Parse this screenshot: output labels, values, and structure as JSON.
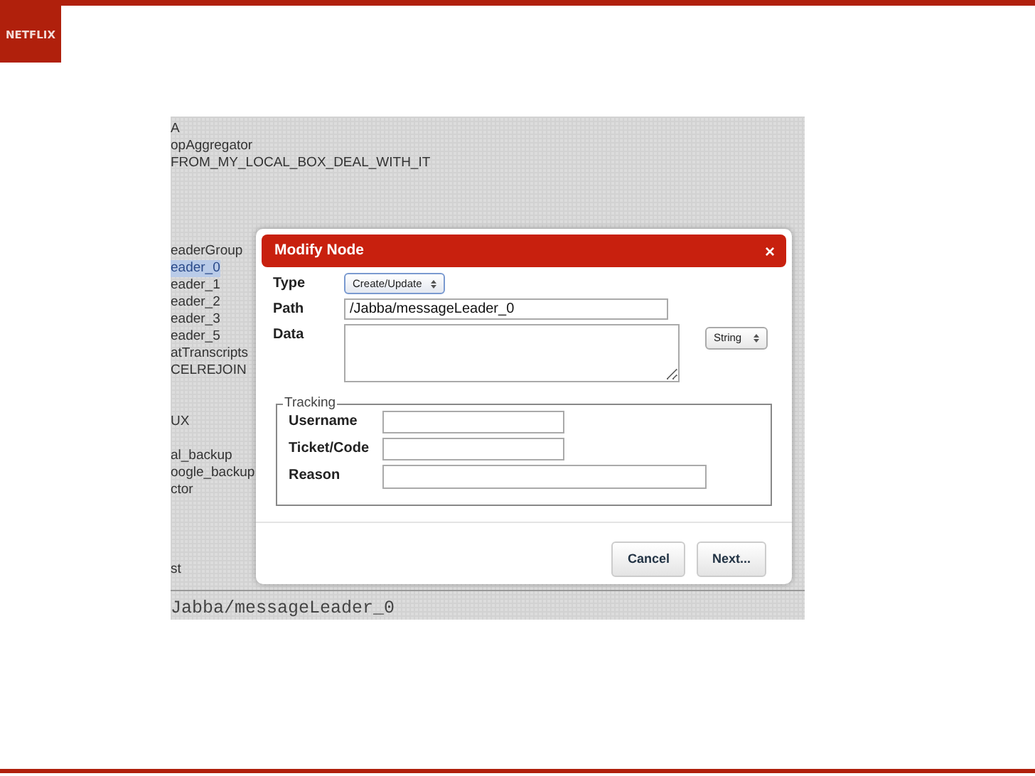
{
  "slide": {
    "logo": "NETFLIX"
  },
  "tree": {
    "groups": [
      {
        "items": [
          {
            "label": "A",
            "selected": false
          },
          {
            "label": "opAggregator",
            "selected": false
          },
          {
            "label": "FROM_MY_LOCAL_BOX_DEAL_WITH_IT",
            "selected": false
          }
        ]
      },
      {
        "items": [
          {
            "label": "eaderGroup",
            "selected": false
          },
          {
            "label": "eader_0",
            "selected": true
          },
          {
            "label": "eader_1",
            "selected": false
          },
          {
            "label": "eader_2",
            "selected": false
          },
          {
            "label": "eader_3",
            "selected": false
          },
          {
            "label": "eader_5",
            "selected": false
          },
          {
            "label": "atTranscripts",
            "selected": false
          },
          {
            "label": "CELREJOIN",
            "selected": false
          }
        ]
      },
      {
        "items": [
          {
            "label": "UX",
            "selected": false
          }
        ]
      },
      {
        "items": [
          {
            "label": "al_backup",
            "selected": false
          },
          {
            "label": "oogle_backup",
            "selected": false
          },
          {
            "label": "ctor",
            "selected": false
          }
        ]
      },
      {
        "items": [
          {
            "label": "st",
            "selected": false
          }
        ]
      }
    ]
  },
  "path_bar": "Jabba/messageLeader_0",
  "dialog": {
    "title": "Modify Node",
    "close": "×",
    "type_label": "Type",
    "type_value": "Create/Update",
    "path_label": "Path",
    "path_value": "/Jabba/messageLeader_0",
    "data_label": "Data",
    "data_type": "String",
    "tracking": {
      "legend": "Tracking",
      "fields": [
        {
          "label": "Username",
          "wide": false
        },
        {
          "label": "Ticket/Code",
          "wide": false
        },
        {
          "label": "Reason",
          "wide": true
        }
      ]
    },
    "buttons": [
      "Cancel",
      "Next..."
    ]
  }
}
